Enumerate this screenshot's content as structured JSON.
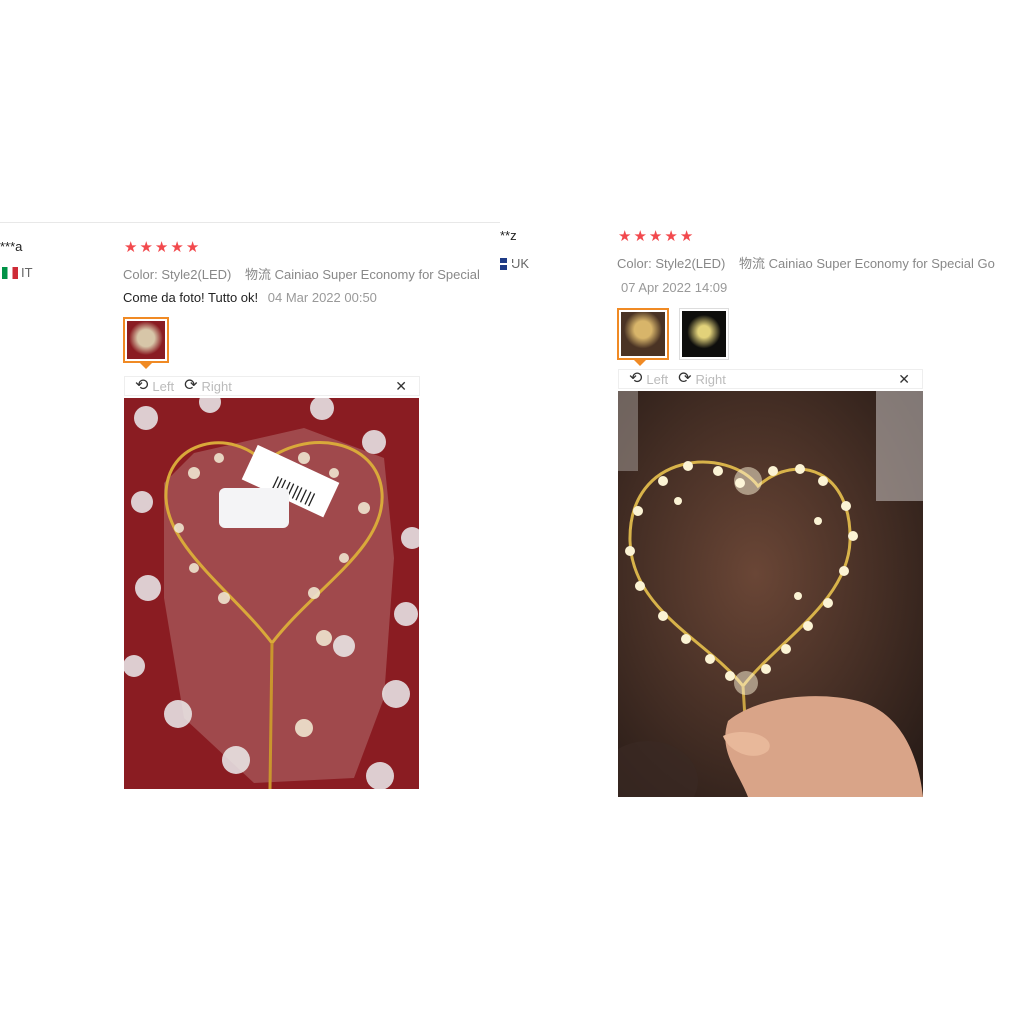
{
  "reviews": [
    {
      "reviewer": "***a",
      "country": "IT",
      "stars": [
        "★",
        "★",
        "★",
        "★",
        "★"
      ],
      "color_label": "Color:",
      "color_value": "Style2(LED)",
      "shipping_label": "物流",
      "shipping_value": "Cainiao Super Economy for Special",
      "text": "Come da foto! Tutto ok!",
      "date": "04 Mar 2022 00:50",
      "viewer": {
        "left_label": "Left",
        "right_label": "Right",
        "close": "✕"
      },
      "thumbnails": [
        "heart-topper-packaged"
      ],
      "photo_icon": "heart-topper-packaged-photo"
    },
    {
      "reviewer": "**z",
      "country": "UK",
      "stars": [
        "★",
        "★",
        "★",
        "★",
        "★"
      ],
      "color_label": "Color:",
      "color_value": "Style2(LED)",
      "shipping_label": "物流",
      "shipping_value": "Cainiao Super Economy for Special Go",
      "text": "",
      "date": "07 Apr 2022 14:09",
      "viewer": {
        "left_label": "Left",
        "right_label": "Right",
        "close": "✕"
      },
      "thumbnails": [
        "heart-topper-lit",
        "heart-topper-lit-dark"
      ],
      "photo_icon": "heart-topper-lit-photo"
    }
  ],
  "colors": {
    "star": "#f2494d",
    "active_thumb": "#f08a24"
  }
}
